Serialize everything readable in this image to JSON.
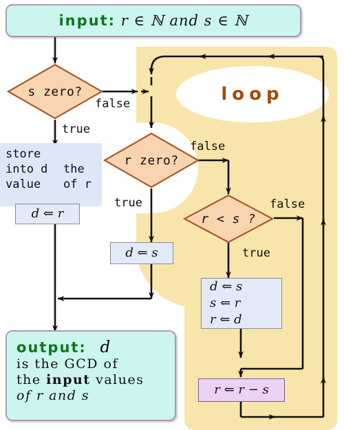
{
  "diagram": {
    "title": "Euclidean GCD algorithm flowchart",
    "colors": {
      "terminal_fill": "#cdf5f0",
      "terminal_border": "#a99bb5",
      "loop_fill": "#f8e5ab",
      "diamond_fill": "#f8d4b0",
      "diamond_border": "#a85a2a",
      "assign_fill": "#e2eaf8",
      "assign_border": "#8a8a9a",
      "pink_fill": "#ecd2f5",
      "pink_border": "#7a5a8a",
      "annotation_fill": "#dce7f7",
      "keyword_green": "#0a7a18",
      "loop_label_brown": "#a44a09",
      "edge_stroke": "#111111"
    }
  },
  "input_node": {
    "name": "input-terminal",
    "keyword": "input:",
    "expression": "r ∈ ℕ  and  s ∈ ℕ",
    "var_r": "r",
    "var_s": "s",
    "set_symbol": "ℕ",
    "member_symbol": "∈",
    "conjunction": "and"
  },
  "decisions": [
    {
      "name": "decision-s-zero",
      "text": "s zero?",
      "var": "s",
      "true_label": "true",
      "false_label": "false"
    },
    {
      "name": "decision-r-zero",
      "text": "r zero?",
      "var": "r",
      "true_label": "true",
      "false_label": "false"
    },
    {
      "name": "decision-r-less-s",
      "text": "r < s ?",
      "var": "r",
      "true_label": "true",
      "false_label": "false"
    }
  ],
  "annotation": {
    "name": "store-annotation",
    "line1_left": "store",
    "line2_left": "into d",
    "line3_left": "value",
    "line1_right": "",
    "line2_right": "the",
    "line3_right": "of r",
    "full_text": "store into d the value of r"
  },
  "assignments": {
    "d_gets_r": {
      "name": "assign-d-gets-r",
      "rows": [
        "d ⇐ r"
      ]
    },
    "d_gets_s": {
      "name": "assign-d-gets-s",
      "rows": [
        "d ⇐ s"
      ]
    },
    "swap_block": {
      "name": "assign-swap-block",
      "rows": [
        "d ⇐ s",
        "s ⇐ r",
        "r ⇐ d"
      ]
    },
    "r_minus_s": {
      "name": "assign-r-minus-s",
      "rows": [
        "r ⇐ r − s"
      ]
    }
  },
  "loop_region": {
    "name": "loop-region",
    "label": "loop"
  },
  "output_node": {
    "name": "output-terminal",
    "keyword": "output:",
    "result_var": "d",
    "line2": "is  the  GCD  of",
    "line3_a": "the ",
    "line3_b": "input",
    "line3_c": " values",
    "line4": "of  r  and  s"
  },
  "edge_labels": {
    "s_zero_false": "false",
    "s_zero_true": "true",
    "r_zero_false": "false",
    "r_zero_true": "true",
    "r_less_s_false": "false",
    "r_less_s_true": "true"
  }
}
